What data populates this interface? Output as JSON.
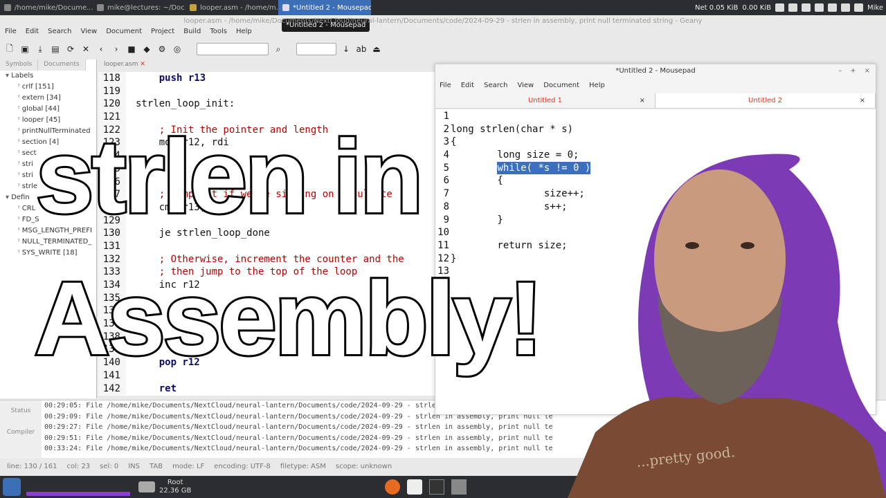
{
  "taskbar": {
    "tasks": [
      {
        "label": "/home/mike/Docume..."
      },
      {
        "label": "mike@lectures: ~/Doc..."
      },
      {
        "label": "looper.asm - /home/m..."
      },
      {
        "label": "*Untitled 2 - Mousepad"
      }
    ],
    "net_label": "Net 0.05 KiB",
    "net_label2": "0.00 KiB",
    "user": "Mike"
  },
  "tooltip": "*Untitled 2 - Mousepad",
  "geany": {
    "title": "looper.asm - /home/mike/Documents/NextCloud/neural-lantern/Documents/code/2024-09-29 - strlen in assembly, print null terminated string - Geany",
    "menu": [
      "File",
      "Edit",
      "Search",
      "View",
      "Document",
      "Project",
      "Build",
      "Tools",
      "Help"
    ],
    "sidebar_tabs": [
      "Symbols",
      "Documents"
    ],
    "tree": [
      {
        "label": "Labels",
        "indent": 0
      },
      {
        "label": "crlf [151]",
        "indent": 1
      },
      {
        "label": "extern [34]",
        "indent": 1
      },
      {
        "label": "global [44]",
        "indent": 1
      },
      {
        "label": "looper [45]",
        "indent": 1
      },
      {
        "label": "printNullTerminated",
        "indent": 1
      },
      {
        "label": "section [4]",
        "indent": 1
      },
      {
        "label": "sect",
        "indent": 1
      },
      {
        "label": "stri",
        "indent": 1
      },
      {
        "label": "stri",
        "indent": 1
      },
      {
        "label": "strle",
        "indent": 1
      },
      {
        "label": "Defin",
        "indent": 0
      },
      {
        "label": "CRL",
        "indent": 1
      },
      {
        "label": "FD_S",
        "indent": 1
      },
      {
        "label": "MSG_LENGTH_PREFI",
        "indent": 1
      },
      {
        "label": "NULL_TERMINATED_",
        "indent": 1
      },
      {
        "label": "SYS_WRITE [18]",
        "indent": 1
      }
    ],
    "file_tab": "looper.asm",
    "code": [
      {
        "n": "118",
        "text": "    push r13",
        "cls": "kw"
      },
      {
        "n": "119",
        "text": "",
        "cls": ""
      },
      {
        "n": "120",
        "text": "strlen_loop_init:",
        "cls": ""
      },
      {
        "n": "121",
        "text": "",
        "cls": ""
      },
      {
        "n": "122",
        "text": "    ; Init the pointer and length",
        "cls": "cm"
      },
      {
        "n": "123",
        "text": "    mov r12, rdi",
        "cls": ""
      },
      {
        "n": "124",
        "text": "",
        "cls": ""
      },
      {
        "n": "125",
        "text": "",
        "cls": ""
      },
      {
        "n": "126",
        "text": "",
        "cls": ""
      },
      {
        "n": "127",
        "text": "    ; Jump out if we're sitting on a null te",
        "cls": "cm"
      },
      {
        "n": "128",
        "text": "    cmp r13, 0",
        "cls": ""
      },
      {
        "n": "129",
        "text": "",
        "cls": ""
      },
      {
        "n": "130",
        "text": "    je strlen_loop_done",
        "cls": ""
      },
      {
        "n": "131",
        "text": "",
        "cls": ""
      },
      {
        "n": "132",
        "text": "    ; Otherwise, increment the counter and the",
        "cls": "cm"
      },
      {
        "n": "133",
        "text": "    ; then jump to the top of the loop",
        "cls": "cm"
      },
      {
        "n": "134",
        "text": "    inc r12",
        "cls": ""
      },
      {
        "n": "135",
        "text": "",
        "cls": ""
      },
      {
        "n": "136",
        "text": "",
        "cls": ""
      },
      {
        "n": "137",
        "text": "",
        "cls": ""
      },
      {
        "n": "138",
        "text": "",
        "cls": ""
      },
      {
        "n": "139",
        "text": "",
        "cls": ""
      },
      {
        "n": "140",
        "text": "    pop r12",
        "cls": "kw"
      },
      {
        "n": "141",
        "text": "",
        "cls": ""
      },
      {
        "n": "142",
        "text": "    ret",
        "cls": "kw"
      }
    ],
    "bottom_tabs": [
      "Status",
      "Compiler"
    ],
    "log": [
      "00:29:05: File /home/mike/Documents/NextCloud/neural-lantern/Documents/code/2024-09-29 - strlen in assembly, print null te",
      "00:29:09: File /home/mike/Documents/NextCloud/neural-lantern/Documents/code/2024-09-29 - strlen in assembly, print null te",
      "00:29:27: File /home/mike/Documents/NextCloud/neural-lantern/Documents/code/2024-09-29 - strlen in assembly, print null te",
      "00:29:51: File /home/mike/Documents/NextCloud/neural-lantern/Documents/code/2024-09-29 - strlen in assembly, print null te",
      "00:33:24: File /home/mike/Documents/NextCloud/neural-lantern/Documents/code/2024-09-29 - strlen in assembly, print null te"
    ],
    "status": [
      "line: 130 / 161",
      "col: 23",
      "sel: 0",
      "INS",
      "TAB",
      "mode: LF",
      "encoding: UTF-8",
      "filetype: ASM",
      "scope: unknown"
    ]
  },
  "mousepad": {
    "title": "*Untitled 2 - Mousepad",
    "menu": [
      "File",
      "Edit",
      "Search",
      "View",
      "Document",
      "Help"
    ],
    "tabs": [
      "Untitled 1",
      "Untitled 2"
    ],
    "lines": [
      {
        "n": "1",
        "pre": "",
        "sel": "",
        "post": ""
      },
      {
        "n": "2",
        "pre": "long strlen(char * s)",
        "sel": "",
        "post": ""
      },
      {
        "n": "3",
        "pre": "{",
        "sel": "",
        "post": ""
      },
      {
        "n": "4",
        "pre": "        long size = 0;",
        "sel": "",
        "post": ""
      },
      {
        "n": "5",
        "pre": "        ",
        "sel": "while( *s != 0 )",
        "post": ""
      },
      {
        "n": "6",
        "pre": "        {",
        "sel": "",
        "post": ""
      },
      {
        "n": "7",
        "pre": "                size++;",
        "sel": "",
        "post": ""
      },
      {
        "n": "8",
        "pre": "                s++;",
        "sel": "",
        "post": ""
      },
      {
        "n": "9",
        "pre": "        }",
        "sel": "",
        "post": ""
      },
      {
        "n": "10",
        "pre": "",
        "sel": "",
        "post": ""
      },
      {
        "n": "11",
        "pre": "        return size;",
        "sel": "",
        "post": ""
      },
      {
        "n": "12",
        "pre": "}",
        "sel": "",
        "post": ""
      },
      {
        "n": "13",
        "pre": "",
        "sel": "",
        "post": ""
      },
      {
        "n": "14",
        "pre": "",
        "sel": "",
        "post": ""
      }
    ]
  },
  "overlay": {
    "line1": "strlen in",
    "line2": "Assembly!"
  },
  "panel": {
    "disk_label": "Root",
    "disk_size": "22.36 GB"
  },
  "shirt_text": "...pretty good."
}
